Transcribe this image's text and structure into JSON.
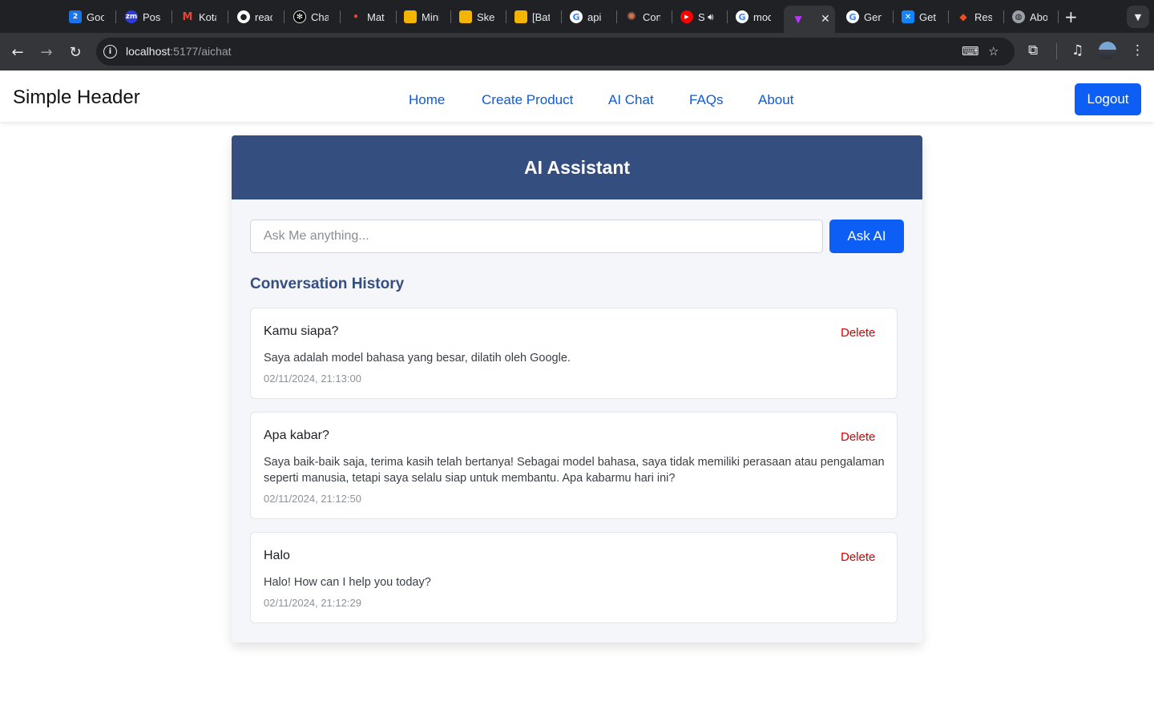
{
  "browser": {
    "tabs": [
      {
        "title": "Goo",
        "icon": "google-calendar-icon",
        "color": "#1a73e8",
        "glyph": "2"
      },
      {
        "title": "Post",
        "icon": "zoom-icon",
        "color": "#2d3bd8",
        "glyph": "zm"
      },
      {
        "title": "Kota",
        "icon": "gmail-icon",
        "color": "#ea4335",
        "glyph": "M"
      },
      {
        "title": "reac",
        "icon": "github-icon",
        "color": "#ffffff",
        "glyph": "●"
      },
      {
        "title": "Cha",
        "icon": "chatgpt-icon",
        "color": "#000000",
        "glyph": "✻"
      },
      {
        "title": "Mat",
        "icon": "dot-icon",
        "color": "#2d3bd8",
        "glyph": "•"
      },
      {
        "title": "Mini",
        "icon": "slides-icon",
        "color": "#f4b400",
        "glyph": ""
      },
      {
        "title": "Ske",
        "icon": "slides-icon",
        "color": "#f4b400",
        "glyph": ""
      },
      {
        "title": "[Bat",
        "icon": "slides-icon",
        "color": "#f4b400",
        "glyph": ""
      },
      {
        "title": "api",
        "icon": "google-icon",
        "color": "#ffffff",
        "glyph": "G"
      },
      {
        "title": "Con",
        "icon": "claude-icon",
        "color": "#d97757",
        "glyph": "✺"
      },
      {
        "title": "S",
        "icon": "youtube-music-icon",
        "color": "#ff0000",
        "glyph": "▶"
      },
      {
        "title": "mod",
        "icon": "google-icon",
        "color": "#ffffff",
        "glyph": "G"
      },
      {
        "title": "",
        "icon": "vite-icon",
        "color": "#bd34fe",
        "glyph": "▼"
      },
      {
        "title": "Gen",
        "icon": "google-icon",
        "color": "#ffffff",
        "glyph": "G"
      },
      {
        "title": "Get",
        "icon": "butterfly-icon",
        "color": "#1185fe",
        "glyph": "✕"
      },
      {
        "title": "Res",
        "icon": "figma-icon",
        "color": "#f24e1e",
        "glyph": "◆"
      },
      {
        "title": "Abo",
        "icon": "globe-icon",
        "color": "#9aa0a6",
        "glyph": "◍"
      }
    ],
    "address": {
      "host": "localhost",
      "path": ":5177/aichat"
    }
  },
  "header": {
    "brand": "Simple Header",
    "nav": [
      {
        "label": "Home"
      },
      {
        "label": "Create Product"
      },
      {
        "label": "AI Chat"
      },
      {
        "label": "FAQs"
      },
      {
        "label": "About"
      }
    ],
    "logout_label": "Logout"
  },
  "assistant": {
    "title": "AI Assistant",
    "input_placeholder": "Ask Me anything...",
    "input_value": "",
    "ask_label": "Ask AI",
    "history_title": "Conversation History",
    "delete_label": "Delete",
    "history": [
      {
        "question": "Kamu siapa?",
        "answer": "Saya adalah model bahasa yang besar, dilatih oleh Google.",
        "time": "02/11/2024, 21:13:00"
      },
      {
        "question": "Apa kabar?",
        "answer": "Saya baik-baik saja, terima kasih telah bertanya! Sebagai model bahasa, saya tidak memiliki perasaan atau pengalaman seperti manusia, tetapi saya selalu siap untuk membantu. Apa kabarmu hari ini?",
        "time": "02/11/2024, 21:12:50"
      },
      {
        "question": "Halo",
        "answer": "Halo! How can I help you today?",
        "time": "02/11/2024, 21:12:29"
      }
    ]
  },
  "colors": {
    "accent": "#0d5ef4",
    "card_header": "#344e80",
    "delete": "#d40000"
  }
}
